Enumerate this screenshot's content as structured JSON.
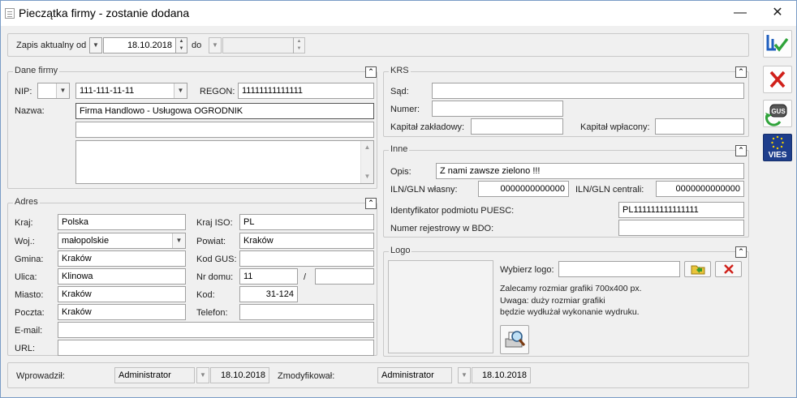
{
  "window": {
    "title": "Pieczątka firmy - zostanie dodana",
    "minimize": "—",
    "close": "✕"
  },
  "record": {
    "label_from": "Zapis aktualny od",
    "date_from": "18.10.2018",
    "label_to": "do",
    "date_to": ""
  },
  "dane_firmy": {
    "legend": "Dane firmy",
    "nip_label": "NIP:",
    "nip_prefix": "",
    "nip": "111-111-11-11",
    "regon_label": "REGON:",
    "regon": "11111111111111",
    "nazwa_label": "Nazwa:",
    "nazwa_line1": "Firma Handlowo - Usługowa OGRODNIK",
    "nazwa_line2": "",
    "nazwa_line3": ""
  },
  "adres": {
    "legend": "Adres",
    "kraj_label": "Kraj:",
    "kraj": "Polska",
    "kraj_iso_label": "Kraj ISO:",
    "kraj_iso": "PL",
    "woj_label": "Woj.:",
    "woj": "małopolskie",
    "powiat_label": "Powiat:",
    "powiat": "Kraków",
    "gmina_label": "Gmina:",
    "gmina": "Kraków",
    "kod_gus_label": "Kod GUS:",
    "kod_gus": "",
    "ulica_label": "Ulica:",
    "ulica": "Klinowa",
    "nr_domu_label": "Nr domu:",
    "nr_domu": "11",
    "slash": "/",
    "nr_lokalu": "",
    "miasto_label": "Miasto:",
    "miasto": "Kraków",
    "kod_label": "Kod:",
    "kod": "31-124",
    "poczta_label": "Poczta:",
    "poczta": "Kraków",
    "telefon_label": "Telefon:",
    "telefon": "",
    "email_label": "E-mail:",
    "email": "",
    "url_label": "URL:",
    "url": ""
  },
  "krs": {
    "legend": "KRS",
    "sad_label": "Sąd:",
    "sad": "",
    "numer_label": "Numer:",
    "numer": "",
    "kapital_zakl_label": "Kapitał zakładowy:",
    "kapital_zakl": "",
    "kapital_wpl_label": "Kapitał wpłacony:",
    "kapital_wpl": ""
  },
  "inne": {
    "legend": "Inne",
    "opis_label": "Opis:",
    "opis": "Z nami zawsze zielono !!!",
    "iln_wlasny_label": "ILN/GLN własny:",
    "iln_wlasny": "0000000000000",
    "iln_centrali_label": "ILN/GLN centrali:",
    "iln_centrali": "0000000000000",
    "puesc_label": "Identyfikator podmiotu PUESC:",
    "puesc": "PL111111111111111",
    "bdo_label": "Numer rejestrowy w BDO:",
    "bdo": ""
  },
  "logo": {
    "legend": "Logo",
    "choose_label": "Wybierz logo:",
    "path": "",
    "note1": "Zalecamy rozmiar grafiki 700x400 px.",
    "note2": "Uwaga: duży rozmiar grafiki",
    "note3": "będzie wydłużał wykonanie wydruku."
  },
  "footer": {
    "wprowadzil_label": "Wprowadził:",
    "wprowadzil_user": "Administrator",
    "wprowadzil_date": "18.10.2018",
    "zmodyfikowal_label": "Zmodyfikował:",
    "zmodyfikowal_user": "Administrator",
    "zmodyfikowal_date": "18.10.2018"
  },
  "side_buttons": {
    "vies_label": "VIES",
    "gus_label": "GUS"
  },
  "colors": {
    "accent": "#1f5fbf",
    "cancel": "#d0201a",
    "vies_bg": "#1e3e8c",
    "vies_star": "#f5d000"
  }
}
